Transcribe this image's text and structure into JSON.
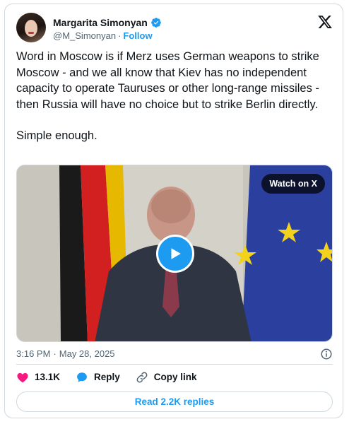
{
  "author": {
    "display_name": "Margarita Simonyan",
    "handle": "@M_Simonyan",
    "separator": "·",
    "follow_label": "Follow"
  },
  "tweet": {
    "text_paragraph_1": "Word in Moscow is if Merz uses German weapons to strike Moscow - and we all know that Kiev has no independent capacity to operate Tauruses or other long-range missiles - then Russia will have no choice but to strike Berlin directly.",
    "text_paragraph_2": "Simple enough."
  },
  "media": {
    "watch_label": "Watch on X"
  },
  "meta": {
    "time": "3:16 PM",
    "separator": "·",
    "date": "May 28, 2025"
  },
  "actions": {
    "like_count": "13.1K",
    "reply_label": "Reply",
    "copy_link_label": "Copy link"
  },
  "read_replies_label": "Read 2.2K replies",
  "colors": {
    "accent": "#1d9bf0",
    "like": "#f91880",
    "text_primary": "#0f1419",
    "text_secondary": "#536471",
    "border": "#cfd9de"
  },
  "icons": {
    "verified": "verified-badge-icon",
    "brand": "x-logo-icon",
    "info": "info-icon",
    "like": "heart-icon",
    "reply": "speech-bubble-icon",
    "copy_link": "link-icon",
    "play": "play-icon"
  }
}
